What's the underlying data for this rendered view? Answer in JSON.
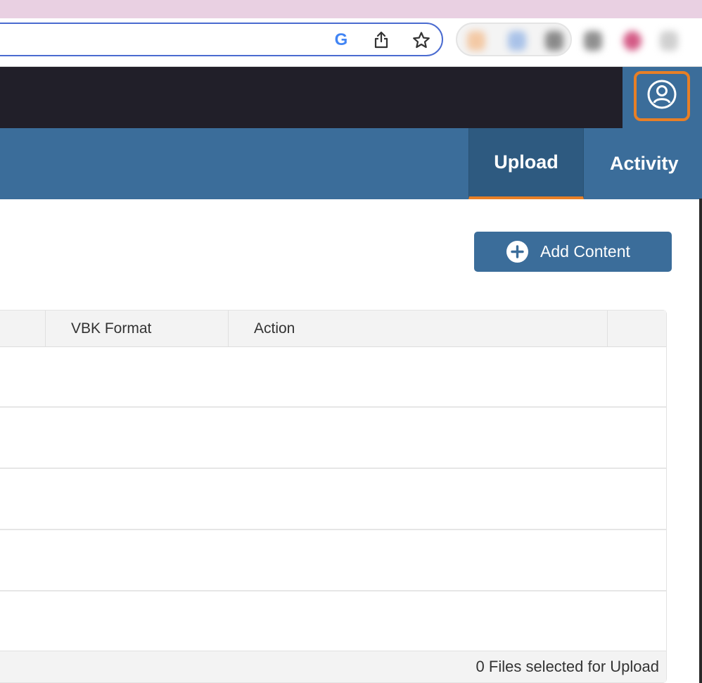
{
  "browser": {
    "omnibox_icons": [
      "google-g-icon",
      "share-icon",
      "bookmark-star-icon"
    ],
    "google_letter": "G"
  },
  "nav": {
    "tabs": [
      {
        "label": "Upload",
        "active": true
      },
      {
        "label": "Activity",
        "active": false
      }
    ]
  },
  "toolbar": {
    "add_content_label": "Add Content"
  },
  "table": {
    "headers": [
      "",
      "VBK Format",
      "Action",
      ""
    ],
    "rows": [
      [],
      [],
      [],
      [],
      []
    ],
    "footer_status": "0 Files selected for Upload"
  },
  "colors": {
    "header_dark": "#211f29",
    "nav_blue": "#3b6d9a",
    "active_tab": "#2e5a80",
    "accent_orange": "#e87f26",
    "browser_tab_strip": "#e9d0e2",
    "omnibox_border": "#4a6bd0"
  }
}
